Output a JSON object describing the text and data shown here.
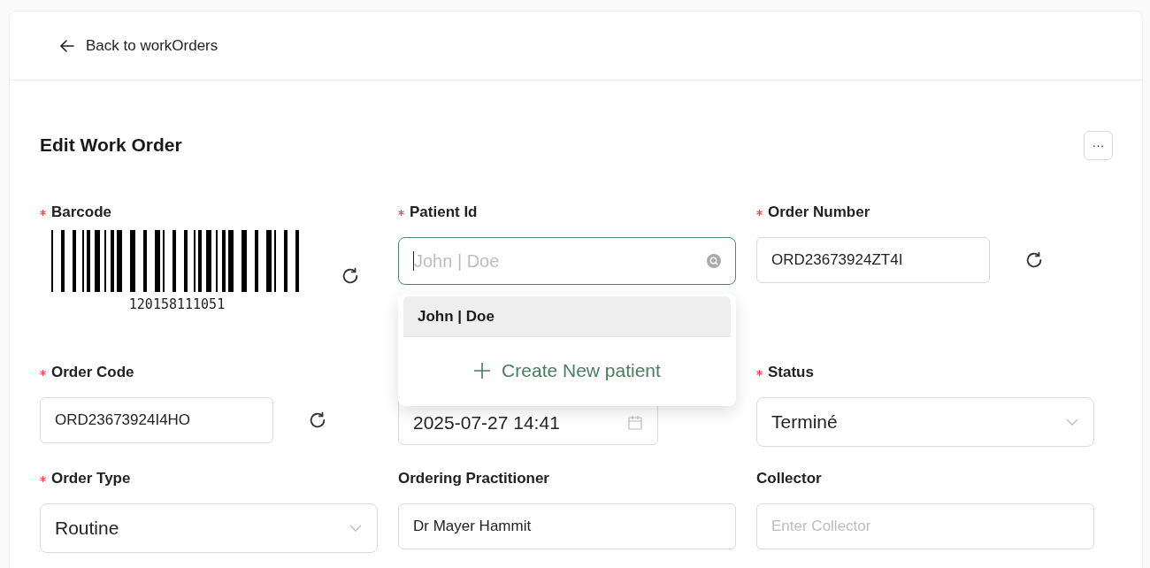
{
  "back_link": {
    "label": "Back to workOrders"
  },
  "title": "Edit Work Order",
  "more_button": {
    "label": "···"
  },
  "fields": [
    {
      "kind": "barcode",
      "label": "Barcode",
      "required": true,
      "value": "120158111051",
      "regenerate": true
    },
    {
      "kind": "combobox",
      "label": "Patient Id",
      "required": true,
      "placeholder": "John | Doe",
      "focused": true,
      "options": [
        {
          "label": "John | Doe",
          "highlighted": true
        }
      ],
      "create_label": "Create New patient"
    },
    {
      "kind": "text",
      "label": "Order Number",
      "required": true,
      "value": "ORD23673924ZT4I",
      "regenerate": true
    },
    {
      "kind": "text",
      "label": "Order Code",
      "required": true,
      "value": "ORD23673924I4HO",
      "regenerate": true
    },
    {
      "kind": "date",
      "value": "2025-07-27 14:41"
    },
    {
      "kind": "select",
      "label": "Status",
      "required": true,
      "value": "Terminé"
    },
    {
      "kind": "select",
      "label": "Order Type",
      "required": true,
      "value": "Routine"
    },
    {
      "kind": "text",
      "label": "Ordering Practitioner",
      "required": false,
      "value": "Dr Mayer Hammit",
      "regenerate": false
    },
    {
      "kind": "text",
      "label": "Collector",
      "required": false,
      "placeholder": "Enter Collector",
      "regenerate": false
    }
  ]
}
